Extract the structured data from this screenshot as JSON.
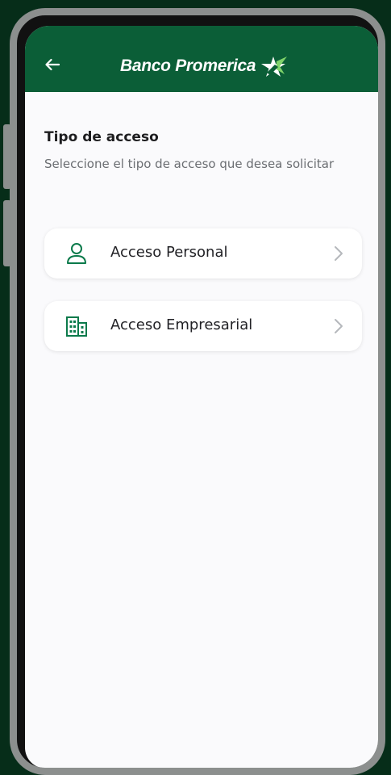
{
  "header": {
    "back_icon": "arrow-left-icon",
    "brand_name": "Banco Promerica",
    "logo_icon": "star-logo-icon",
    "background_color": "#0b5e37"
  },
  "content": {
    "title": "Tipo de acceso",
    "subtitle": "Seleccione el tipo de acceso que desea solicitar",
    "options": [
      {
        "label": "Acceso Personal",
        "icon": "person-icon",
        "chevron": "chevron-right-icon"
      },
      {
        "label": "Acceso Empresarial",
        "icon": "building-icon",
        "chevron": "chevron-right-icon"
      }
    ],
    "accent_color": "#0b7a4b"
  }
}
